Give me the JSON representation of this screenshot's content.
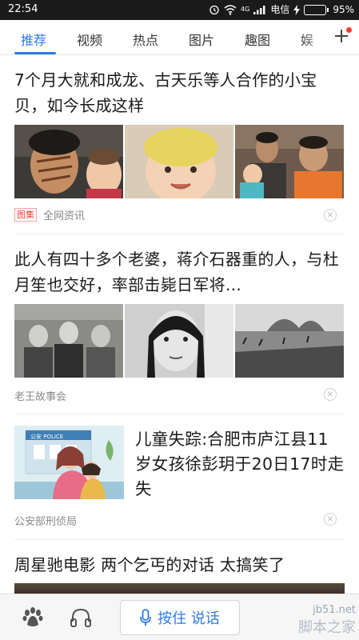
{
  "status_bar": {
    "time": "22:54",
    "network": "4G",
    "carrier": "电信",
    "battery_percent": "95%",
    "battery_level": 0.95,
    "icons": [
      "alarm-icon",
      "wifi-icon",
      "signal-icon",
      "charging-icon",
      "battery-icon"
    ]
  },
  "tabs": [
    {
      "label": "推荐",
      "active": true
    },
    {
      "label": "视频"
    },
    {
      "label": "热点"
    },
    {
      "label": "图片"
    },
    {
      "label": "趣图"
    },
    {
      "label": "娱"
    }
  ],
  "articles": [
    {
      "headline": "7个月大就和成龙、古天乐等人合作的小宝贝，如今长成这样",
      "tag": "图集",
      "source": "全网资讯"
    },
    {
      "headline": "此人有四十多个老婆，蒋介石器重的人，与杜月笙也交好，率部击毙日军将…",
      "source": "老王故事会"
    },
    {
      "headline": "儿童失踪:合肥市庐江县11岁女孩徐彭玥于20日17时走失",
      "thumb_text": "公安 POLICE",
      "source": "公安部刑侦局"
    },
    {
      "headline": "周星驰电影 两个乞丐的对话 太搞笑了"
    }
  ],
  "bottom_bar": {
    "talk_label": "按住 说话",
    "icons": [
      "baidu-paw-icon",
      "headphone-icon",
      "microphone-icon"
    ]
  },
  "watermark": {
    "line1": "jb51.net",
    "line2": "脚本之家"
  },
  "colors": {
    "accent": "#2f7be6",
    "tag_red": "#e8463b"
  }
}
